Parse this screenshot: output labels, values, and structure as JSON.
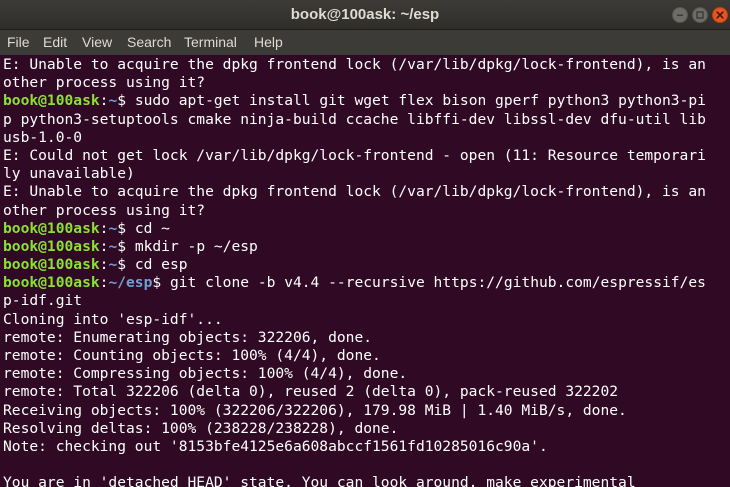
{
  "window": {
    "title": "book@100ask: ~/esp"
  },
  "menu": {
    "items": [
      "File",
      "Edit",
      "View",
      "Search",
      "Terminal",
      "Help"
    ]
  },
  "colors": {
    "background": "#300a24",
    "prompt_user": "#8ae234",
    "prompt_path": "#729fcf",
    "text": "#ffffff"
  },
  "terminal": {
    "lines": [
      {
        "text": "E: Unable to acquire the dpkg frontend lock (/var/lib/dpkg/lock-frontend), is an"
      },
      {
        "text": "other process using it?"
      },
      {
        "user": "book@100ask",
        "sep": ":",
        "path": "~",
        "prompt": "$ ",
        "text": "sudo apt-get install git wget flex bison gperf python3 python3-pi"
      },
      {
        "text": "p python3-setuptools cmake ninja-build ccache libffi-dev libssl-dev dfu-util lib"
      },
      {
        "text": "usb-1.0-0"
      },
      {
        "text": "E: Could not get lock /var/lib/dpkg/lock-frontend - open (11: Resource temporari"
      },
      {
        "text": "ly unavailable)"
      },
      {
        "text": "E: Unable to acquire the dpkg frontend lock (/var/lib/dpkg/lock-frontend), is an"
      },
      {
        "text": "other process using it?"
      },
      {
        "user": "book@100ask",
        "sep": ":",
        "path": "~",
        "prompt": "$ ",
        "text": "cd ~"
      },
      {
        "user": "book@100ask",
        "sep": ":",
        "path": "~",
        "prompt": "$ ",
        "text": "mkdir -p ~/esp"
      },
      {
        "user": "book@100ask",
        "sep": ":",
        "path": "~",
        "prompt": "$ ",
        "text": "cd esp"
      },
      {
        "user": "book@100ask",
        "sep": ":",
        "path": "~/esp",
        "prompt": "$ ",
        "text": "git clone -b v4.4 --recursive https://github.com/espressif/es"
      },
      {
        "text": "p-idf.git"
      },
      {
        "text": "Cloning into 'esp-idf'..."
      },
      {
        "text": "remote: Enumerating objects: 322206, done."
      },
      {
        "text": "remote: Counting objects: 100% (4/4), done."
      },
      {
        "text": "remote: Compressing objects: 100% (4/4), done."
      },
      {
        "text": "remote: Total 322206 (delta 0), reused 2 (delta 0), pack-reused 322202"
      },
      {
        "text": "Receiving objects: 100% (322206/322206), 179.98 MiB | 1.40 MiB/s, done."
      },
      {
        "text": "Resolving deltas: 100% (238228/238228), done."
      },
      {
        "text": "Note: checking out '8153bfe4125e6a608abccf1561fd10285016c90a'."
      },
      {
        "text": ""
      },
      {
        "text": "You are in 'detached HEAD' state. You can look around, make experimental"
      }
    ]
  }
}
